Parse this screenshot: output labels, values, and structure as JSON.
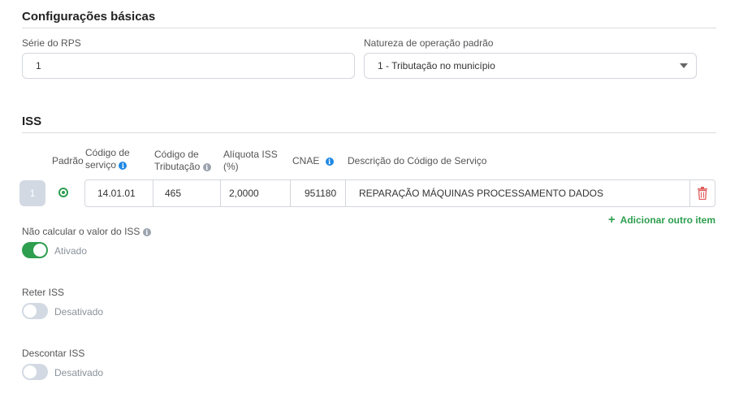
{
  "basic": {
    "title": "Configurações básicas",
    "rps_series_label": "Série do RPS",
    "rps_series_value": "1",
    "nature_label": "Natureza de operação padrão",
    "nature_value": "1 - Tributação no município"
  },
  "iss": {
    "title": "ISS",
    "columns": {
      "default": "Padrão",
      "service_code_line1": "Código de",
      "service_code_line2": "serviço",
      "tax_code_line1": "Código de",
      "tax_code_line2": "Tributação",
      "rate_line1": "Alíquota ISS",
      "rate_line2": "(%)",
      "cnae": "CNAE",
      "description": "Descrição do Código de Serviço"
    },
    "rows": [
      {
        "number": "1",
        "service_code": "14.01.01",
        "tax_code": "465",
        "rate": "2,0000",
        "cnae": "951180",
        "description": "REPARAÇÃO MÁQUINAS PROCESSAMENTO DADOS"
      }
    ],
    "add_item": "Adicionar outro item",
    "not_calc_label": "Não calcular o valor do ISS",
    "not_calc_state": "Ativado",
    "not_calc_on": true,
    "retain_label": "Reter ISS",
    "retain_state": "Desativado",
    "retain_on": false,
    "discount_label": "Descontar ISS",
    "discount_state": "Desativado",
    "discount_on": false
  },
  "icons": {
    "info": "info-icon",
    "trash": "trash-icon",
    "dropdown": "chevron-down-icon",
    "plus": "plus-icon"
  },
  "colors": {
    "accent_green": "#2e9e4f",
    "info_blue": "#1e88e5",
    "danger_red": "#e05a5a"
  }
}
